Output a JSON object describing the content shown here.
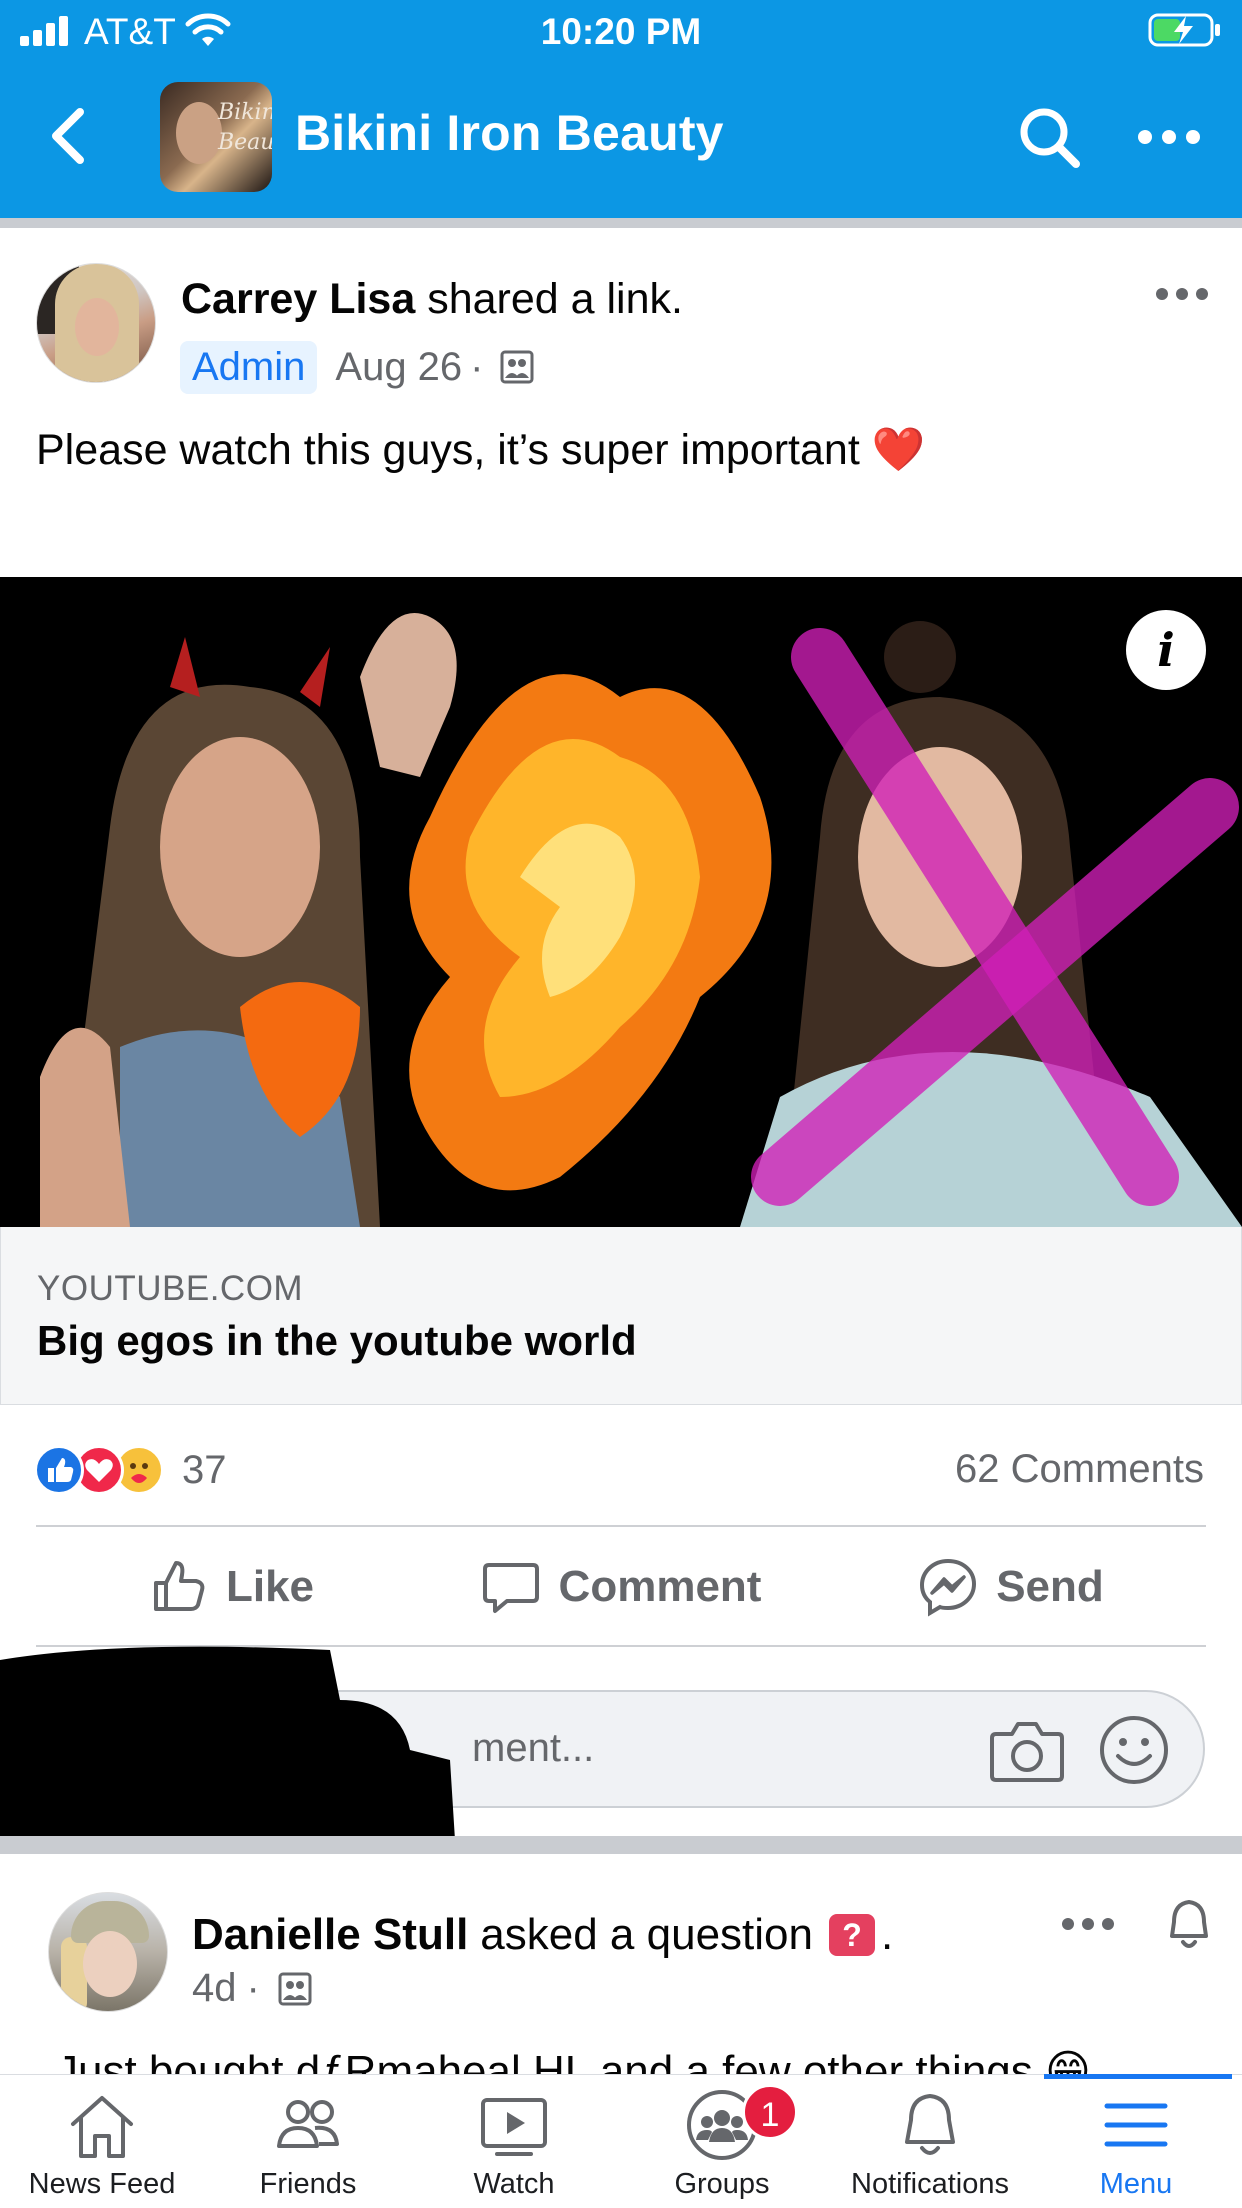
{
  "status_bar": {
    "carrier": "AT&T",
    "time": "10:20 PM",
    "battery_state": "charging"
  },
  "header": {
    "title": "Bikini Iron Beauty",
    "avatar_script": [
      "Bikin",
      "Beau"
    ],
    "back_icon": "chevron-left-icon",
    "search_icon": "search-icon",
    "more_icon": "more-horizontal-icon",
    "bg_color": "#0c97e4"
  },
  "post1": {
    "author": "Carrey Lisa",
    "action_text": "shared a link.",
    "badge": "Admin",
    "date": "Aug 26",
    "separator": "·",
    "privacy_icon": "group-icon",
    "text": "Please watch this guys, it’s super important ❤️",
    "link": {
      "domain": "YOUTUBE.COM",
      "title": "Big egos in the youtube world",
      "info_label": "i"
    },
    "reaction_count": "37",
    "reactions": [
      "like",
      "love",
      "care"
    ],
    "comments_count": "62 Comments",
    "actions": {
      "like": "Like",
      "comment": "Comment",
      "send": "Send"
    },
    "comment_input": {
      "placeholder": "Write a comment...",
      "visible_text": "ment..."
    }
  },
  "post2": {
    "author": "Danielle Stull",
    "action_text": "asked a question",
    "question_badge": "?",
    "trailing": ".",
    "date": "4d",
    "separator": "·",
    "text": "Just bought dƒRmaheal HL and a few other things 😁"
  },
  "tabbar": {
    "tabs": [
      {
        "label": "News Feed",
        "icon": "home-icon"
      },
      {
        "label": "Friends",
        "icon": "friends-icon"
      },
      {
        "label": "Watch",
        "icon": "watch-icon"
      },
      {
        "label": "Groups",
        "icon": "groups-icon",
        "badge": "1"
      },
      {
        "label": "Notifications",
        "icon": "bell-icon"
      },
      {
        "label": "Menu",
        "icon": "menu-icon",
        "active": true
      }
    ]
  },
  "colors": {
    "accent": "#1877f2",
    "secondary_text": "#65676b",
    "love": "#f0284a",
    "badge_red": "#e41e3f"
  }
}
